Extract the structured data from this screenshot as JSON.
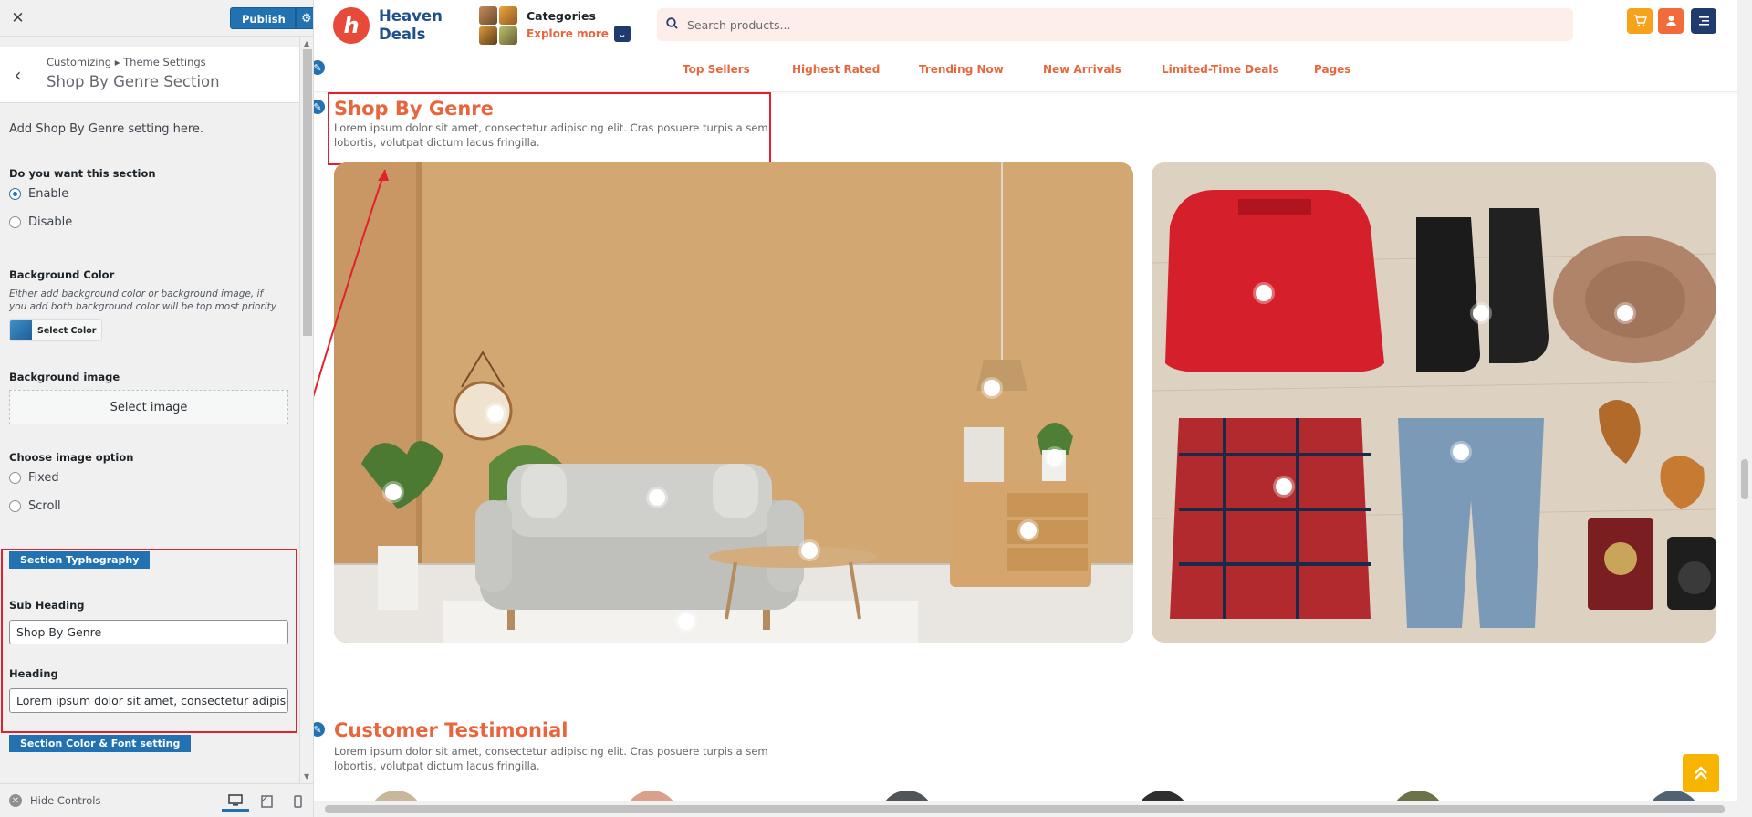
{
  "customizer": {
    "close_icon": "close-icon",
    "publish_label": "Publish",
    "publish_settings_icon": "gear-icon",
    "breadcrumb": "Customizing ▸ Theme Settings",
    "section_title": "Shop By Genre Section",
    "description": "Add Shop By Genre setting here.",
    "enable_section": {
      "label": "Do you want this section",
      "options": [
        "Enable",
        "Disable"
      ],
      "selected": "Enable"
    },
    "background_color": {
      "label": "Background Color",
      "note": "Either add background color or background image, if you add both background color will be top most priority",
      "button_label": "Select Color",
      "swatch": "#2f7ec0"
    },
    "background_image": {
      "label": "Background image",
      "button_label": "Select image"
    },
    "image_option": {
      "label": "Choose image option",
      "options": [
        "Fixed",
        "Scroll"
      ],
      "selected": ""
    },
    "typography_tag": "Section Typhography",
    "sub_heading": {
      "label": "Sub Heading",
      "value": "Shop By Genre"
    },
    "heading": {
      "label": "Heading",
      "value": "Lorem ipsum dolor sit amet, consectetur adipiscing elit."
    },
    "color_font_tag": "Section Color & Font setting",
    "hide_controls": "Hide Controls"
  },
  "site": {
    "brand_line1": "Heaven",
    "brand_line2": "Deals",
    "categories_label": "Categories",
    "explore_more": "Explore more",
    "search_placeholder": "Search products...",
    "nav": [
      "Top Sellers",
      "Highest Rated",
      "Trending Now",
      "New Arrivals",
      "Limited-Time Deals",
      "Pages"
    ],
    "colors": {
      "accent": "#e8663d",
      "brand_blue": "#1f4f8c",
      "cart": "#f7a21b",
      "user": "#f26b3a",
      "menu": "#1f3b6e"
    }
  },
  "shop_by_genre": {
    "title": "Shop By Genre",
    "description": "Lorem ipsum dolor sit amet, consectetur adipiscing elit. Cras posuere turpis a sem lobortis, volutpat dictum lacus fringilla."
  },
  "testimonial": {
    "title": "Customer Testimonial",
    "description": "Lorem ipsum dolor sit amet, consectetur adipiscing elit. Cras posuere turpis a sem lobortis, volutpat dictum lacus fringilla."
  }
}
